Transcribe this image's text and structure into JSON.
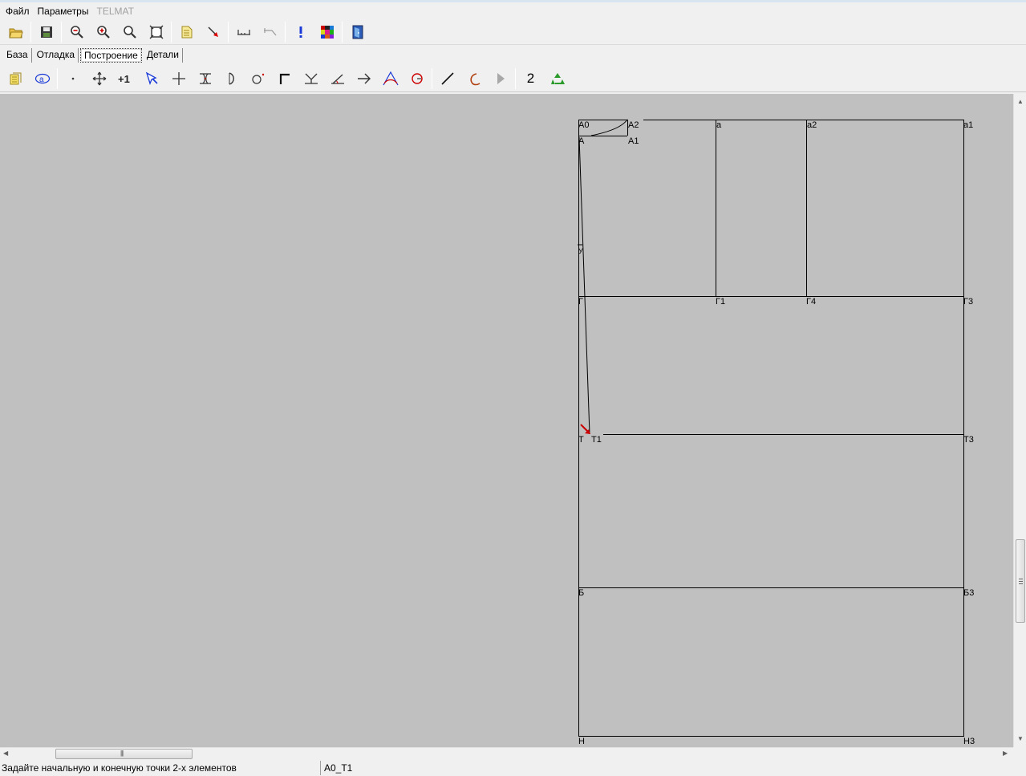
{
  "menu": {
    "items": [
      "Файл",
      "Параметры"
    ],
    "disabled_item": "TELMAT"
  },
  "toolbar_main": {
    "icons": [
      "open-folder-icon",
      "save-disk-icon",
      "zoom-out-icon",
      "zoom-in-icon",
      "zoom-icon",
      "fit-window-icon",
      "document-icon",
      "red-pointer-icon",
      "measure-ruler-icon",
      "measure-angle-icon",
      "info-exclamation-icon",
      "color-palette-icon",
      "exit-door-icon"
    ]
  },
  "tabs": [
    "База",
    "Отладка",
    "Построение",
    "Детали"
  ],
  "active_tab": "Построение",
  "toolbar_build": {
    "counter_label": "2",
    "icons": [
      "notes-icon",
      "formula-a-icon",
      "point-icon",
      "move-icon",
      "increment-icon",
      "select-icon",
      "cross-point-icon",
      "split-icon",
      "half-arc-icon",
      "circle-point-icon",
      "corner-icon",
      "perpendicular-icon",
      "angle-icon",
      "arrow-right-icon",
      "triangle-curve-icon",
      "arc-red-icon",
      "line-icon",
      "curve-icon",
      "play-icon",
      "recycle-icon"
    ]
  },
  "drawing": {
    "points": {
      "A0": "А0",
      "A2": "А2",
      "A": "А",
      "A1": "А1",
      "a": "а",
      "a2": "а2",
      "a1": "а1",
      "Y": "У",
      "G": "Г",
      "G1": "Г1",
      "G4": "Г4",
      "G3": "Г3",
      "T": "Т",
      "T1": "Т1",
      "T3": "Т3",
      "B": "Б",
      "B3": "Б3",
      "N": "Н",
      "N3": "Н3"
    },
    "line_color": "#000000",
    "marker_color": "#cc0000"
  },
  "status": {
    "message": "Задайте начальную и конечную точки 2-х элементов",
    "element": "А0_Т1"
  }
}
